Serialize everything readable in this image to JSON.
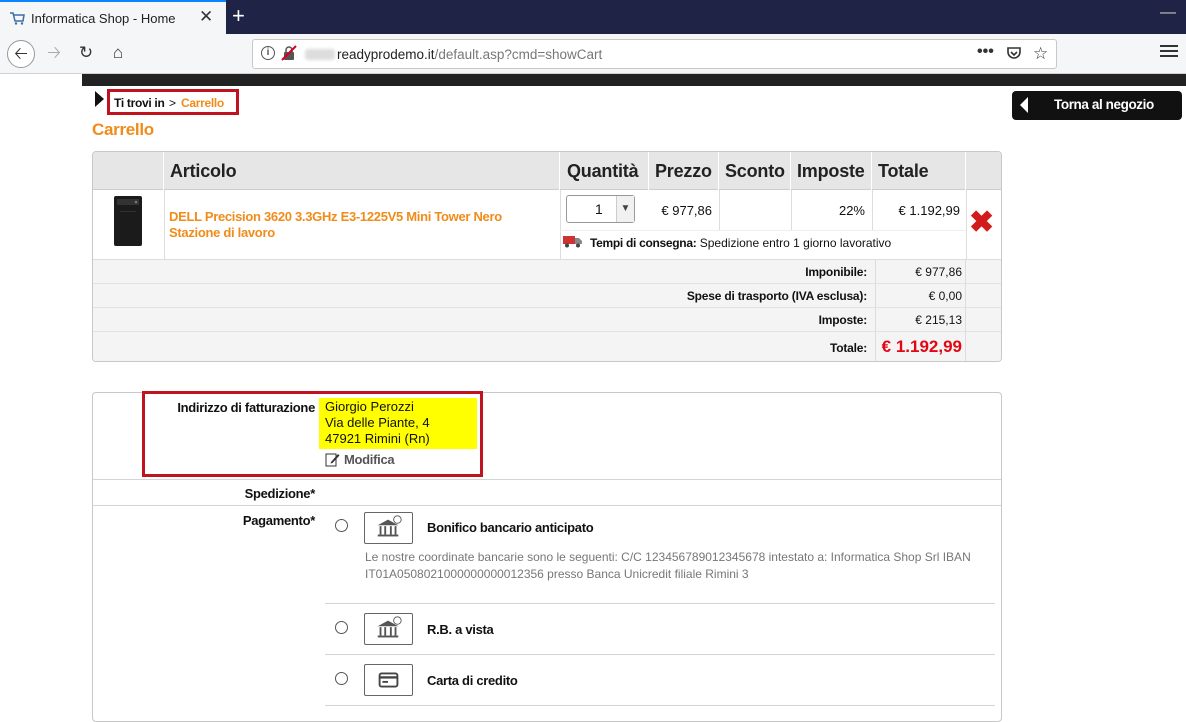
{
  "browser": {
    "tab_title": "Informatica Shop - Home",
    "url_domain": "readyprodemo.it",
    "url_path": "/default.asp?cmd=showCart",
    "tab_close": "✕",
    "new_tab": "+",
    "minimize": "—",
    "back": "🡠",
    "forward": "🡢",
    "reload": "↻",
    "home": "⌂",
    "more": "•••",
    "bookmark": "☆",
    "info": "i"
  },
  "breadcrumb": {
    "prefix": "Ti trovi in",
    "separator": ">",
    "current": "Carrello"
  },
  "back_to_shop": "Torna al negozio",
  "page_title": "Carrello",
  "cart": {
    "headers": [
      "Articolo",
      "Quantità",
      "Prezzo",
      "Sconto",
      "Imposte",
      "Totale"
    ],
    "item": {
      "name": "DELL Precision 3620 3.3GHz E3-1225V5 Mini Tower Nero Stazione di lavoro",
      "quantity": "1",
      "price": "€ 977,86",
      "discount": "",
      "tax": "22%",
      "total": "€ 1.192,99",
      "delivery_label": "Tempi di consegna:",
      "delivery_text": "Spedizione entro 1 giorno lavorativo",
      "remove": "✖"
    },
    "summary": {
      "imponibile_label": "Imponibile:",
      "imponibile": "€ 977,86",
      "shipping_label": "Spese di trasporto (IVA esclusa):",
      "shipping": "€ 0,00",
      "tax_label": "Imposte:",
      "tax": "€ 215,13",
      "total_label": "Totale:",
      "total": "€ 1.192,99"
    }
  },
  "checkout": {
    "billing_label": "Indirizzo di fatturazione",
    "billing_address": [
      "Giorgio Perozzi",
      "Via delle Piante, 4",
      "47921 Rimini (Rn)"
    ],
    "edit_label": "Modifica",
    "shipping_label": "Spedizione*",
    "payment_label": "Pagamento*",
    "payment_methods": [
      {
        "name": "Bonifico bancario anticipato",
        "icon": "bank-icon",
        "description": "Le nostre coordinate bancarie sono le seguenti: C/C 123456789012345678 intestato a: Informatica Shop Srl IBAN IT01A0508021000000000012356 presso Banca Unicredit filiale Rimini 3"
      },
      {
        "name": "R.B. a vista",
        "icon": "bank-icon"
      },
      {
        "name": "Carta di credito",
        "icon": "credit-card-icon"
      }
    ]
  },
  "colors": {
    "accent": "#f08c1a",
    "highlight_red": "#c1121f",
    "total_red": "#e30613",
    "address_bg": "#ffff00"
  }
}
